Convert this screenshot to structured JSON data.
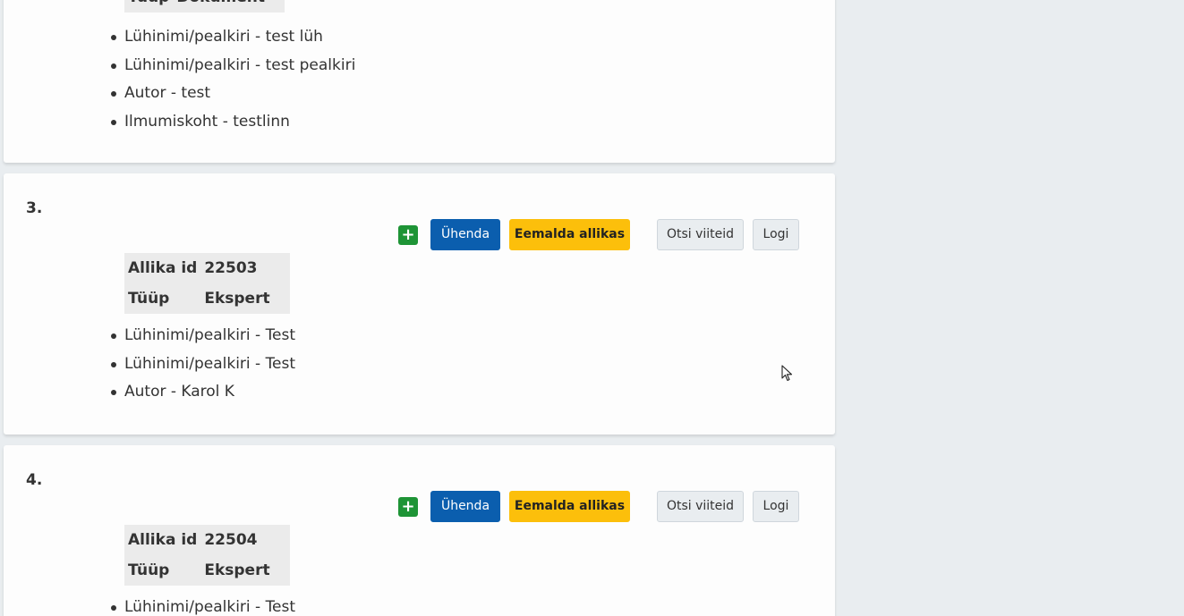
{
  "card2": {
    "table": {
      "type_label": "Tüüp",
      "type_value": "Dokument"
    },
    "fields": [
      "Lühinimi/pealkiri - test lüh",
      "Lühinimi/pealkiri - test pealkiri",
      "Autor - test",
      "Ilmumiskoht - testlinn"
    ]
  },
  "card3": {
    "number": "3.",
    "buttons": {
      "plus": "+",
      "join": "Ühenda",
      "remove": "Eemalda allikas",
      "search": "Otsi viiteid",
      "log": "Logi"
    },
    "table": {
      "id_label": "Allika id",
      "id_value": "22503",
      "type_label": "Tüüp",
      "type_value": "Ekspert"
    },
    "fields": [
      "Lühinimi/pealkiri - Test",
      "Lühinimi/pealkiri - Test",
      "Autor - Karol K"
    ]
  },
  "card4": {
    "number": "4.",
    "buttons": {
      "plus": "+",
      "join": "Ühenda",
      "remove": "Eemalda allikas",
      "search": "Otsi viiteid",
      "log": "Logi"
    },
    "table": {
      "id_label": "Allika id",
      "id_value": "22504",
      "type_label": "Tüüp",
      "type_value": "Ekspert"
    },
    "fields": [
      "Lühinimi/pealkiri - Test"
    ]
  },
  "colors": {
    "background": "#e9edf0",
    "card": "#fdfdfd",
    "join_button": "#0b5eae",
    "remove_button": "#fcbf0b",
    "plus_button": "#1e9436",
    "table_bg": "#ebebeb"
  },
  "icons": {
    "plus": "plus-icon",
    "cursor": "mouse-cursor-icon"
  }
}
